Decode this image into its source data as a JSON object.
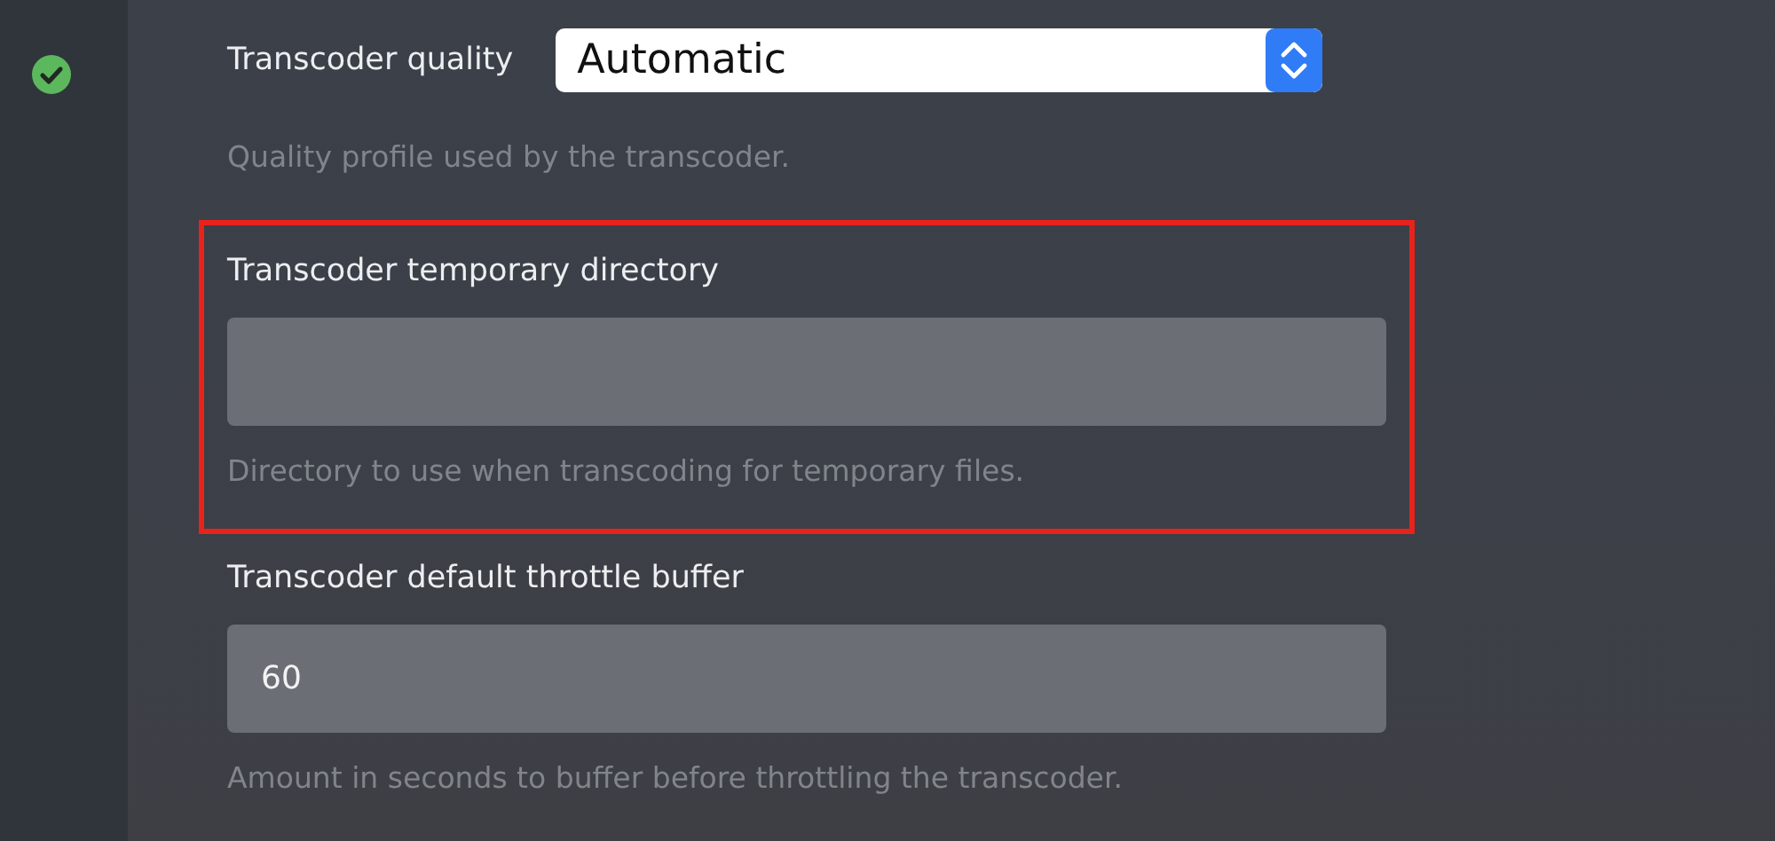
{
  "sidebar": {
    "ok": true
  },
  "settings": [
    {
      "kind": "select",
      "label": "Transcoder quality",
      "value": "Automatic",
      "help": "Quality profile used by the transcoder.",
      "highlighted": false
    },
    {
      "kind": "text",
      "label": "Transcoder temporary directory",
      "help": "Directory to use when transcoding for temporary files.",
      "highlighted": true
    },
    {
      "kind": "text",
      "label": "Transcoder default throttle buffer",
      "value": "60",
      "help": "Amount in seconds to buffer before throttling the transcoder.",
      "highlighted": false
    }
  ]
}
